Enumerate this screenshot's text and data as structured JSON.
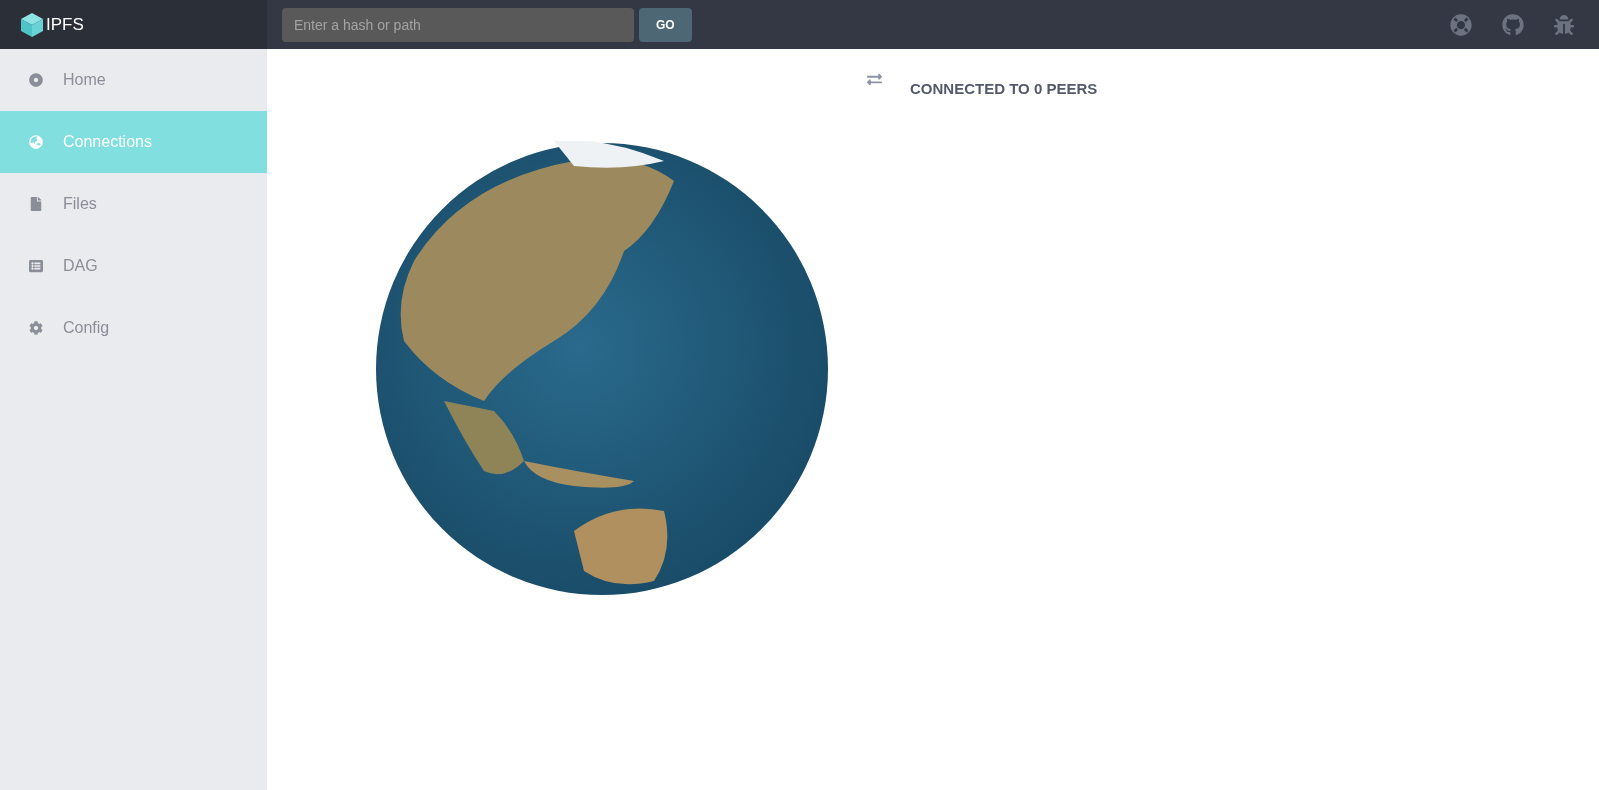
{
  "app": {
    "logo_text": "IPFS"
  },
  "search": {
    "placeholder": "Enter a hash or path",
    "button": "GO"
  },
  "sidebar": {
    "items": [
      {
        "label": "Home",
        "selected": false
      },
      {
        "label": "Connections",
        "selected": true
      },
      {
        "label": "Files",
        "selected": false
      },
      {
        "label": "DAG",
        "selected": false
      },
      {
        "label": "Config",
        "selected": false
      }
    ]
  },
  "connections": {
    "title": "CONNECTED TO 0 PEERS"
  }
}
